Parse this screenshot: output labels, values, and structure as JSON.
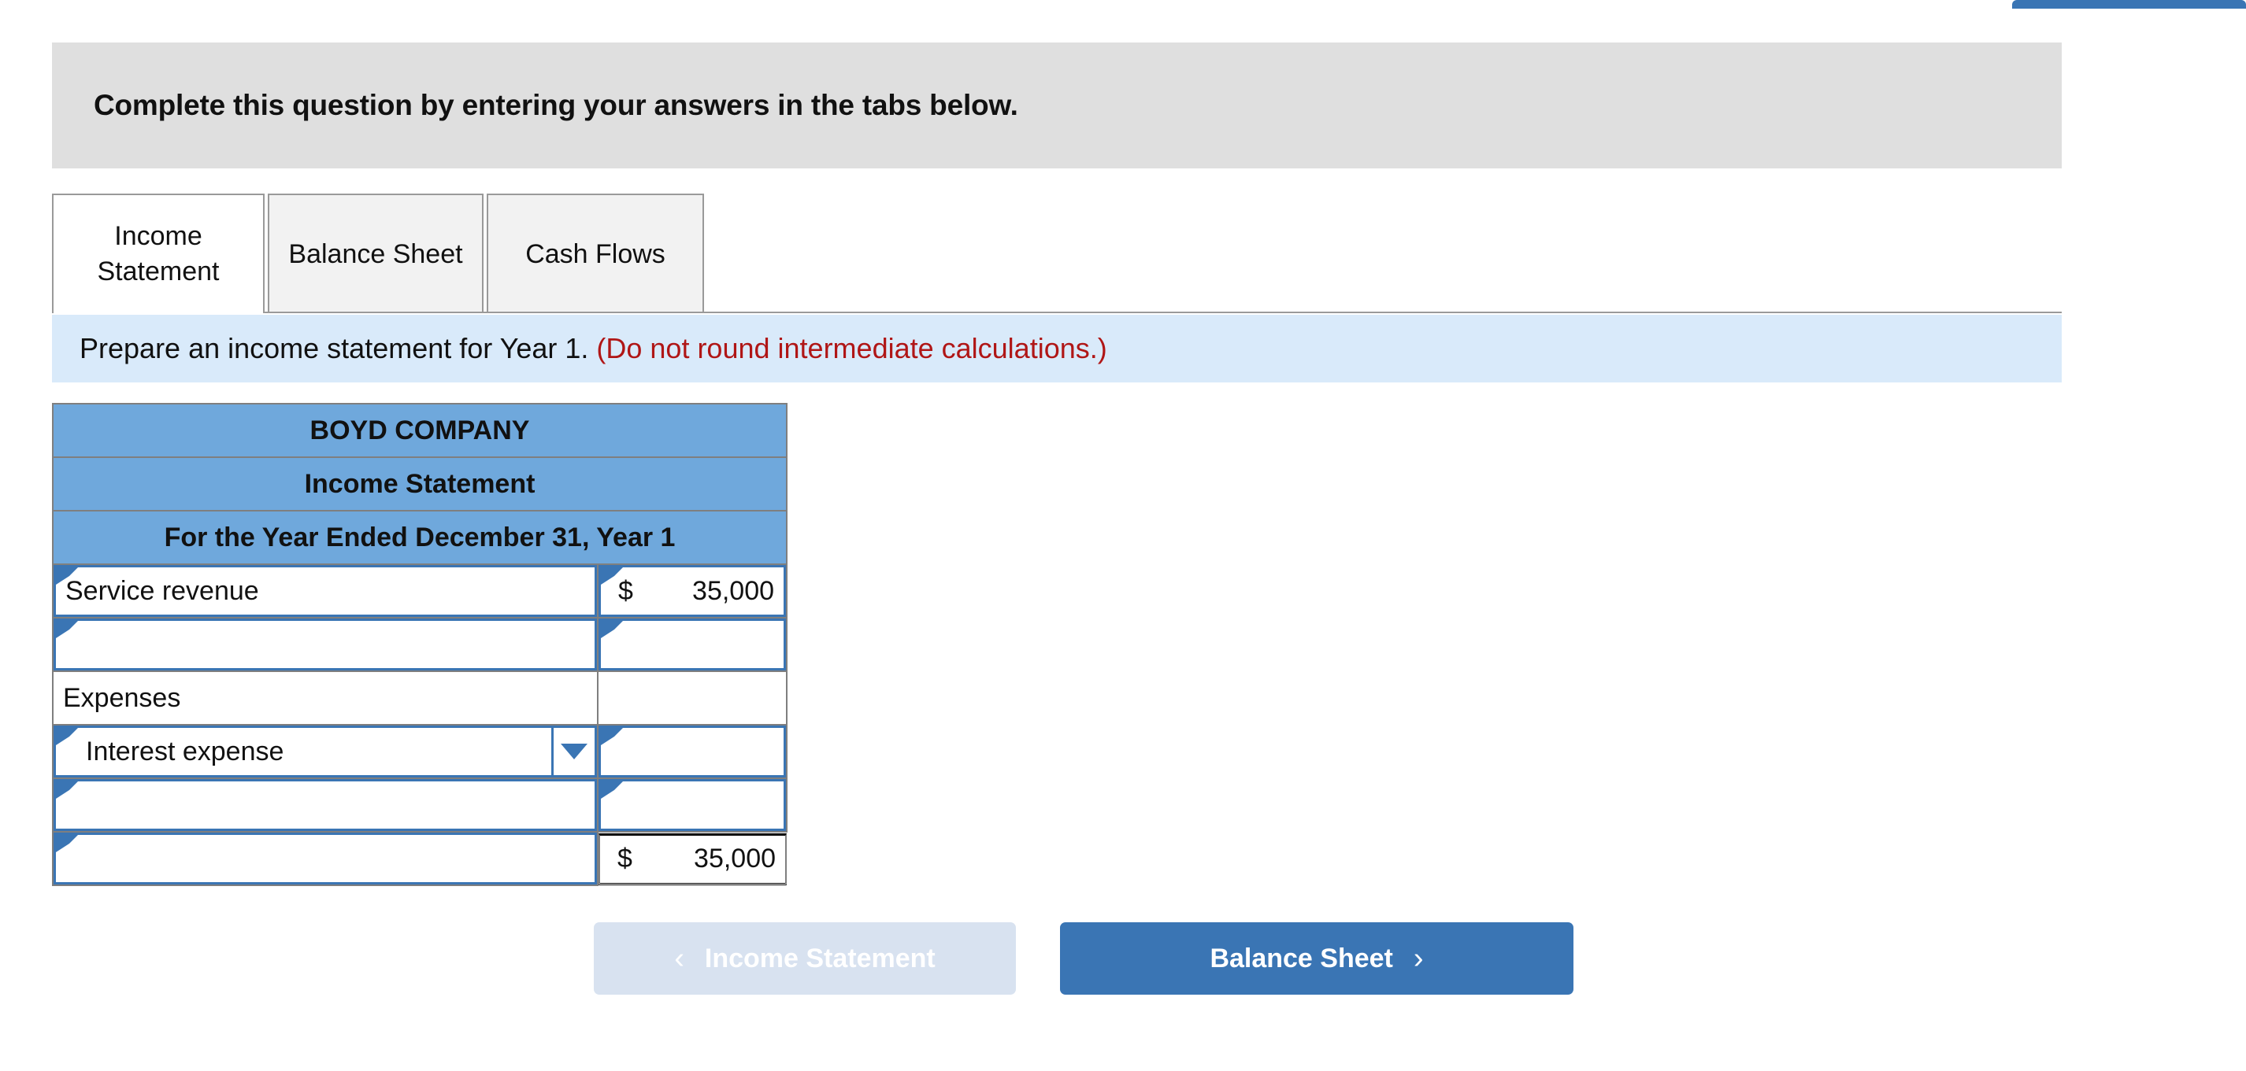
{
  "top_bar": {
    "visible": true,
    "color": "#3a75b4"
  },
  "question_banner": {
    "text": "Complete this question by entering your answers in the tabs below.",
    "background": "#dfdfdf"
  },
  "tabs": {
    "active_index": 0,
    "items": [
      {
        "label": "Income Statement"
      },
      {
        "label": "Balance Sheet"
      },
      {
        "label": "Cash Flows"
      }
    ]
  },
  "requirement": {
    "text": "Prepare an income statement for Year 1.",
    "note": "(Do not round intermediate calculations.)",
    "note_color": "#b01616",
    "background": "#d9eafa"
  },
  "worksheet": {
    "header_background": "#6fa8dc",
    "titles": [
      "BOYD COMPANY",
      "Income Statement",
      "For the Year Ended December 31, Year 1"
    ],
    "rows": [
      {
        "kind": "input-value",
        "label": "Service revenue",
        "currency": "$",
        "amount": "35,000"
      },
      {
        "kind": "input-value",
        "label": "",
        "currency": "",
        "amount": ""
      },
      {
        "kind": "plain",
        "label": "Expenses",
        "currency": "",
        "amount": ""
      },
      {
        "kind": "dropdown-value",
        "label": "Interest expense",
        "currency": "",
        "amount": ""
      },
      {
        "kind": "input-value",
        "label": "",
        "currency": "",
        "amount": ""
      },
      {
        "kind": "input-total",
        "label": "",
        "currency": "$",
        "amount": "35,000"
      }
    ]
  },
  "nav": {
    "prev": {
      "label": "Income Statement",
      "chevron": "‹",
      "enabled": false
    },
    "next": {
      "label": "Balance Sheet",
      "chevron": "›",
      "enabled": true
    }
  }
}
